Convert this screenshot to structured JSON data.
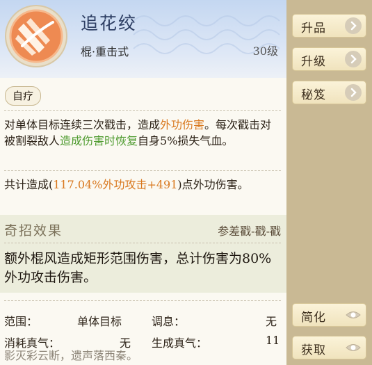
{
  "skill": {
    "name": "追花绞",
    "type": "棍·重击式",
    "level": "30级",
    "tag": "自疗"
  },
  "description": {
    "part1": "对单体目标连续三次戳击，造成",
    "hl1": "外功伤害",
    "part2": "。每次戳击对被割裂敌人",
    "hl2": "造成伤害时恢复",
    "part3": "自身5%损失气血。"
  },
  "total": {
    "prefix": "共计造成(",
    "value": "117.04%外功攻击+491",
    "suffix": ")点外功伤害。"
  },
  "special": {
    "title": "奇招效果",
    "pattern": "参差戳-戳-戳",
    "description": "额外棍风造成矩形范围伤害，总计伤害为80%外功攻击伤害。"
  },
  "stats": {
    "range_label": "范围：",
    "range_value": "单体目标",
    "breath_label": "调息：",
    "breath_value": "无",
    "cost_label": "消耗真气：",
    "cost_value": "无",
    "gen_label": "生成真气：",
    "gen_value": "11"
  },
  "poem": "影灭彩云断，遗声落西秦。",
  "sidebar": {
    "upgrade_quality": "升品",
    "upgrade_level": "升级",
    "secret_manual": "秘笈",
    "simplify": "简化",
    "obtain": "获取"
  },
  "colors": {
    "highlight_orange": "#d9781e",
    "highlight_green": "#4e9b2f",
    "header_blue": "#c4d7f1",
    "side_background": "#c9b994"
  }
}
